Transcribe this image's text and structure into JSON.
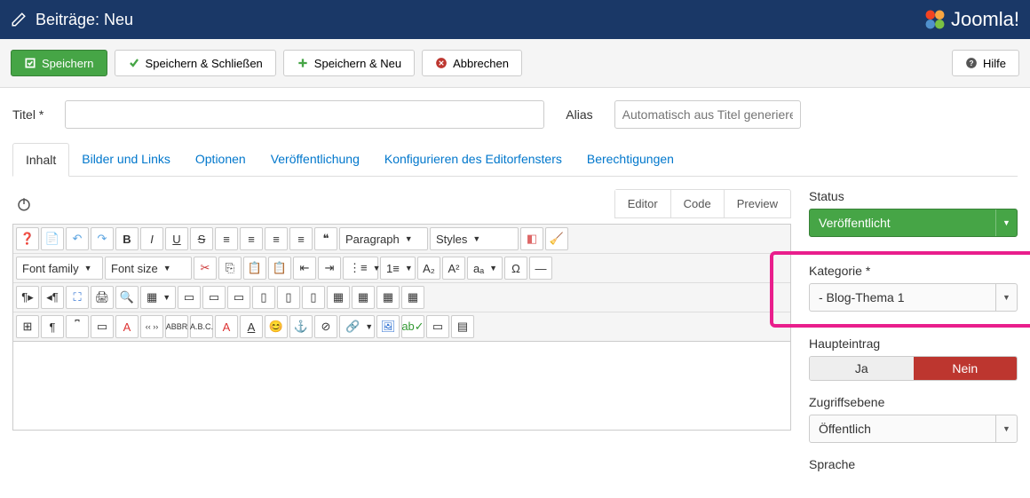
{
  "header": {
    "title": "Beiträge: Neu",
    "brand": "Joomla!"
  },
  "toolbar": {
    "save": "Speichern",
    "saveClose": "Speichern & Schließen",
    "saveNew": "Speichern & Neu",
    "cancel": "Abbrechen",
    "help": "Hilfe"
  },
  "fields": {
    "titleLabel": "Titel *",
    "aliasLabel": "Alias",
    "aliasPlaceholder": "Automatisch aus Titel generieren"
  },
  "tabs": [
    "Inhalt",
    "Bilder und Links",
    "Optionen",
    "Veröffentlichung",
    "Konfigurieren des Editorfensters",
    "Berechtigungen"
  ],
  "editorTabs": {
    "editor": "Editor",
    "code": "Code",
    "preview": "Preview"
  },
  "editorSelects": {
    "paragraph": "Paragraph",
    "styles": "Styles",
    "fontFamily": "Font family",
    "fontSize": "Font size"
  },
  "sidebar": {
    "statusLabel": "Status",
    "statusValue": "Veröffentlicht",
    "categoryLabel": "Kategorie *",
    "categoryValue": "- Blog-Thema 1",
    "featuredLabel": "Haupteintrag",
    "yes": "Ja",
    "no": "Nein",
    "accessLabel": "Zugriffsebene",
    "accessValue": "Öffentlich",
    "languageLabel": "Sprache"
  }
}
